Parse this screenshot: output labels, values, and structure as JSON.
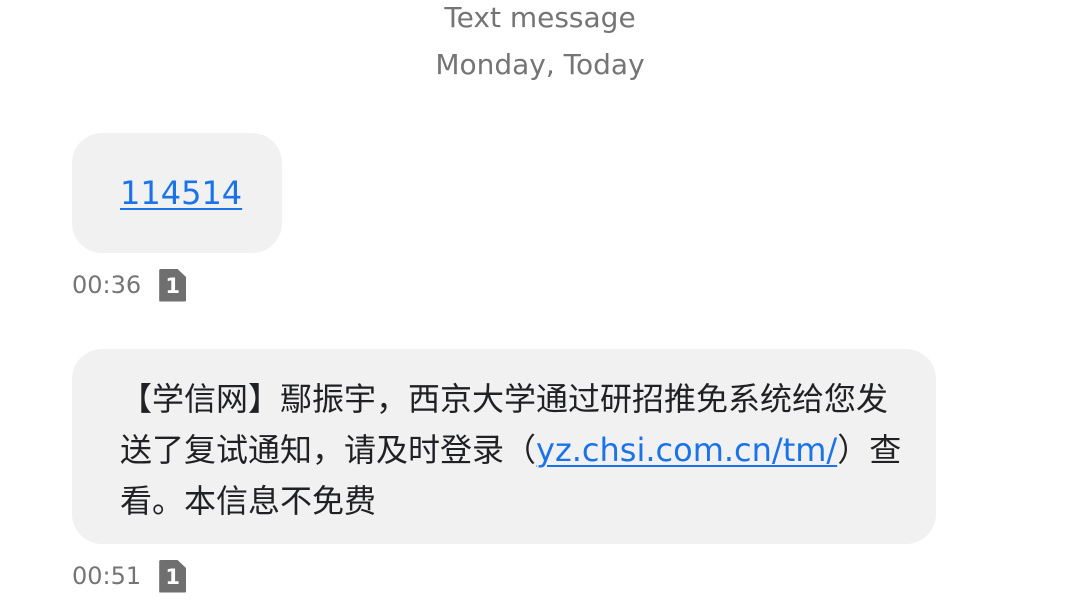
{
  "header": {
    "type": "Text message",
    "date": "Monday, Today"
  },
  "messages": [
    {
      "link": "114514",
      "time": "00:36",
      "sim": "1"
    },
    {
      "text_before": "【学信网】鄢振宇，西京大学通过研招推免系统给您发送了复试通知，请及时登录（",
      "link": "yz.chsi.com.cn/tm/",
      "text_after": "）查看。本信息不免费",
      "time": "00:51",
      "sim": "1"
    }
  ],
  "colors": {
    "bubble": "#f1f1f1",
    "link": "#1a73e8",
    "meta": "#757575"
  },
  "icons": {
    "sim": "sim-card-icon"
  }
}
